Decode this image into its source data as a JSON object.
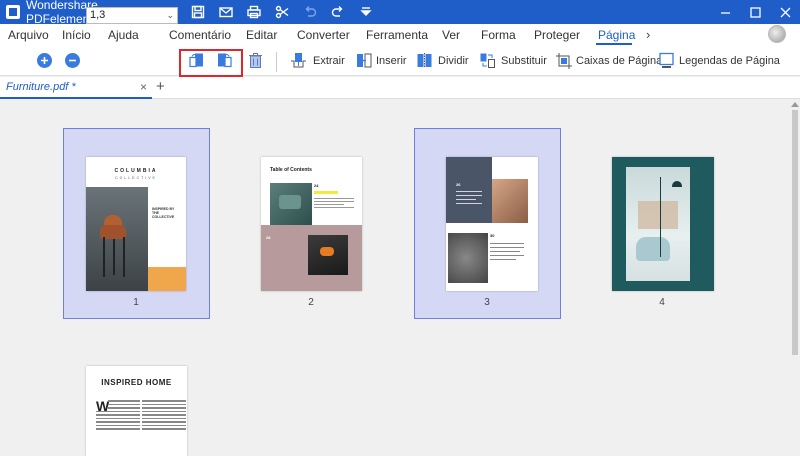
{
  "app": {
    "title": "Wondershare PDFelement"
  },
  "quick_access": [
    "folder-icon",
    "save-icon",
    "mail-icon",
    "print-icon",
    "scissors-icon",
    "undo-icon",
    "redo-icon",
    "dropdown-icon"
  ],
  "menu": {
    "items": [
      "Arquivo",
      "Início",
      "Ajuda",
      "Comentário",
      "Editar",
      "Converter",
      "Ferramenta",
      "Ver",
      "Forma",
      "Proteger",
      "Página"
    ],
    "active": "Página",
    "more": "›"
  },
  "toolbar": {
    "zoom_in": "zoom-in-icon",
    "zoom_out": "zoom-out-icon",
    "page_range_value": "1,3",
    "caret": "⌄",
    "rotate_left": "rotate-left-icon",
    "rotate_right": "rotate-right-icon",
    "delete": "trash-icon",
    "extract_label": "Extrair",
    "insert_label": "Inserir",
    "split_label": "Dividir",
    "replace_label": "Substituir",
    "page_boxes_label": "Caixas de Página",
    "page_labels_label": "Legendas de Página",
    "highlight_color": "#e0262b"
  },
  "tabs": {
    "document": "Furniture.pdf *",
    "close": "×",
    "new": "+"
  },
  "pages": [
    {
      "number": "1",
      "selected": true,
      "title": "COLUMBIA",
      "subtitle": "COLLECTIVE",
      "body": "INSPIRED BY THE COLLECTIVE"
    },
    {
      "number": "2",
      "selected": false,
      "title": "Table of Contents",
      "num_a": "24",
      "num_b": "28"
    },
    {
      "number": "3",
      "selected": true,
      "num_a": "26",
      "num_b": "30"
    },
    {
      "number": "4",
      "selected": false
    },
    {
      "number": "",
      "selected": false,
      "title": "INSPIRED HOME"
    }
  ],
  "colors": {
    "accent": "#1f5dc8",
    "selection": "#d4d8f5",
    "selection_border": "#6f7fe0"
  }
}
